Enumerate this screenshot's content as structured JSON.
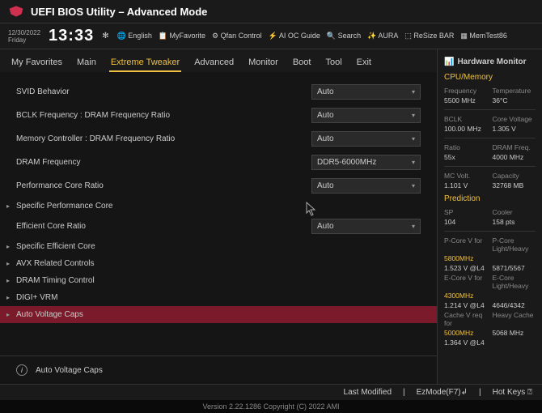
{
  "header": {
    "title": "UEFI BIOS Utility – Advanced Mode"
  },
  "datetime": {
    "date": "12/30/2022",
    "day": "Friday",
    "time": "13:33"
  },
  "toplinks": [
    "English",
    "MyFavorite",
    "Qfan Control",
    "AI OC Guide",
    "Search",
    "AURA",
    "ReSize BAR",
    "MemTest86"
  ],
  "tabs": [
    "My Favorites",
    "Main",
    "Extreme Tweaker",
    "Advanced",
    "Monitor",
    "Boot",
    "Tool",
    "Exit"
  ],
  "settings": [
    {
      "label": "SVID Behavior",
      "value": "Auto",
      "dropdown": true
    },
    {
      "label": "BCLK Frequency : DRAM Frequency Ratio",
      "value": "Auto",
      "dropdown": true
    },
    {
      "label": "Memory Controller : DRAM Frequency Ratio",
      "value": "Auto",
      "dropdown": true
    },
    {
      "label": "DRAM Frequency",
      "value": "DDR5-6000MHz",
      "dropdown": true
    },
    {
      "label": "Performance Core Ratio",
      "value": "Auto",
      "dropdown": true
    },
    {
      "label": "Specific Performance Core",
      "expandable": true
    },
    {
      "label": "Efficient Core Ratio",
      "value": "Auto",
      "dropdown": true
    },
    {
      "label": "Specific Efficient Core",
      "expandable": true
    },
    {
      "label": "AVX Related Controls",
      "expandable": true
    },
    {
      "label": "DRAM Timing Control",
      "expandable": true
    },
    {
      "label": "DIGI+ VRM",
      "expandable": true
    },
    {
      "label": "Auto Voltage Caps",
      "expandable": true,
      "selected": true
    }
  ],
  "info": {
    "text": "Auto Voltage Caps"
  },
  "hwmon": {
    "title": "Hardware Monitor",
    "cpu_section": "CPU/Memory",
    "frequency_l": "Frequency",
    "frequency_v": "5500 MHz",
    "temp_l": "Temperature",
    "temp_v": "36°C",
    "bclk_l": "BCLK",
    "bclk_v": "100.00 MHz",
    "corev_l": "Core Voltage",
    "corev_v": "1.305 V",
    "ratio_l": "Ratio",
    "ratio_v": "55x",
    "dramf_l": "DRAM Freq.",
    "dramf_v": "4000 MHz",
    "mcv_l": "MC Volt.",
    "mcv_v": "1.101 V",
    "cap_l": "Capacity",
    "cap_v": "32768 MB",
    "pred_section": "Prediction",
    "sp_l": "SP",
    "sp_v": "104",
    "cooler_l": "Cooler",
    "cooler_v": "158 pts",
    "pcv_l": "P-Core V for",
    "pcv_h": "5800MHz",
    "pcv_v": "1.523 V @L4",
    "pclh_l": "P-Core Light/Heavy",
    "pclh_v": "5871/5567",
    "ecv_l": "E-Core V for",
    "ecv_h": "4300MHz",
    "ecv_v": "1.214 V @L4",
    "eclh_l": "E-Core Light/Heavy",
    "eclh_v": "4646/4342",
    "cvr_l": "Cache V req for",
    "cvr_h": "5000MHz",
    "cvr_v": "1.364 V @L4",
    "hc_l": "Heavy Cache",
    "hc_v": "5068 MHz"
  },
  "footer": {
    "lastmod": "Last Modified",
    "ezmode": "EzMode(F7)",
    "hotkeys": "Hot Keys"
  },
  "version": "Version 2.22.1286 Copyright (C) 2022 AMI"
}
